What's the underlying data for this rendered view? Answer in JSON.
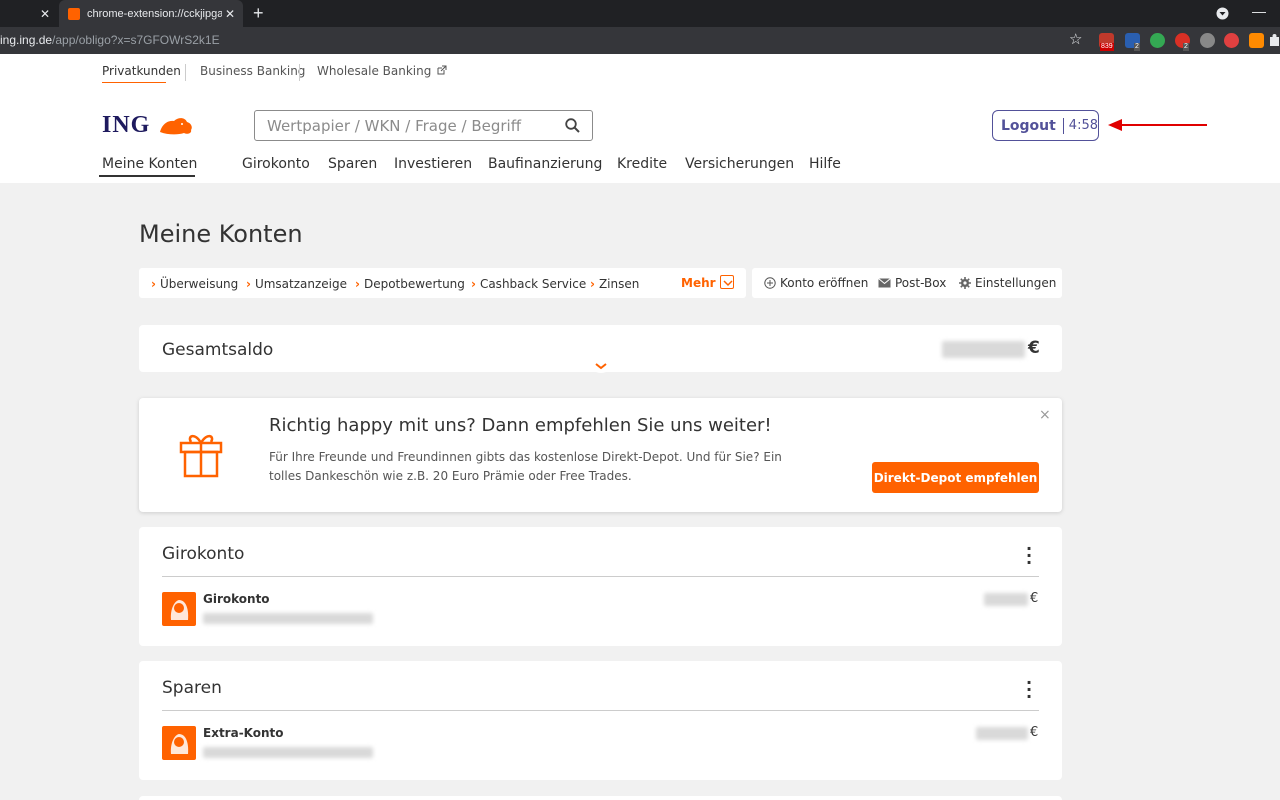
{
  "browser": {
    "inactive_tab_close": "✕",
    "active_tab_title": "chrome-extension://cckjipgaohk",
    "active_tab_close": "✕",
    "new_tab": "+",
    "url_host": "ing.ing.de",
    "url_path": "/app/obligo?x=s7GFOWrS2k1E",
    "extension_badges": [
      "839",
      "2",
      "2"
    ],
    "minimize": "—"
  },
  "segments": {
    "privat": "Privatkunden",
    "business": "Business Banking",
    "wholesale": "Wholesale Banking"
  },
  "logo_text": "ING",
  "search": {
    "placeholder": "Wertpapier / WKN / Frage / Begriff"
  },
  "logout": {
    "label": "Logout",
    "timer": "4:58"
  },
  "mainnav": [
    "Meine Konten",
    "Girokonto",
    "Sparen",
    "Investieren",
    "Baufinanzierung",
    "Kredite",
    "Versicherungen",
    "Hilfe"
  ],
  "page_title": "Meine Konten",
  "quick_links": [
    "Überweisung",
    "Umsatzanzeige",
    "Depotbewertung",
    "Cashback Service",
    "Zinsen"
  ],
  "more_label": "Mehr",
  "service_links": [
    "Konto eröffnen",
    "Post-Box",
    "Einstellungen"
  ],
  "total": {
    "label": "Gesamtsaldo",
    "currency": "€"
  },
  "promo": {
    "title": "Richtig happy mit uns? Dann empfehlen Sie uns weiter!",
    "text": "Für Ihre Freunde und Freundinnen gibts das kostenlose Direkt-Depot. Und für Sie? Ein tolles Dankeschön wie z.B. 20 Euro Prämie oder Free Trades.",
    "button": "Direkt-Depot empfehlen",
    "close": "×"
  },
  "sections": [
    {
      "title": "Girokonto",
      "account": "Girokonto",
      "currency": "€"
    },
    {
      "title": "Sparen",
      "account": "Extra-Konto",
      "currency": "€"
    }
  ],
  "colors": {
    "brand_orange": "#ff6200",
    "brand_navy": "#525199",
    "logo_navy": "#1e1a5e",
    "annotation_red": "#e00000"
  }
}
